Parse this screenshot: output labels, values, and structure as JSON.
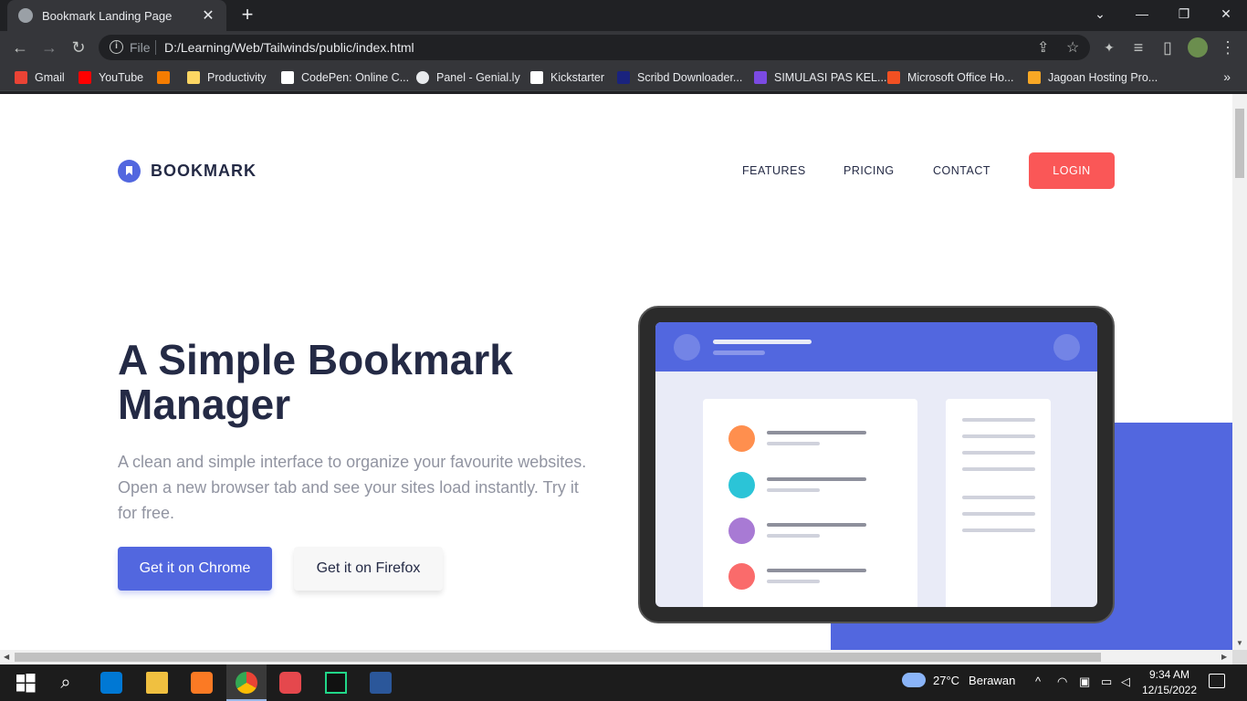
{
  "browser": {
    "tab_title": "Bookmark Landing Page",
    "tab_close": "✕",
    "new_tab": "+",
    "window_controls": {
      "chevron": "⌄",
      "minimize": "—",
      "restore": "❐",
      "close": "✕"
    },
    "nav": {
      "back": "←",
      "forward": "→",
      "reload": "↻"
    },
    "omnibox": {
      "scheme_label": "File",
      "info": "i",
      "url": "D:/Learning/Web/Tailwinds/public/index.html",
      "share": "⇪",
      "star": "☆"
    },
    "toolbar_icons": {
      "extensions": "✦",
      "media": "≡",
      "sidepanel": "▯",
      "menu": "⋮"
    },
    "bookmarks": [
      {
        "label": "Gmail",
        "color": "#ea4335"
      },
      {
        "label": "YouTube",
        "color": "#ff0000"
      },
      {
        "label": "",
        "color": "#f57c00"
      },
      {
        "label": "Productivity",
        "color": "#fdd663"
      },
      {
        "label": "CodePen: Online C...",
        "color": "#ffffff"
      },
      {
        "label": "Panel - Genial.ly",
        "color": "#e8eaed"
      },
      {
        "label": "Kickstarter",
        "color": "#ffffff"
      },
      {
        "label": "Scribd Downloader...",
        "color": "#1a237e"
      },
      {
        "label": "SIMULASI PAS KEL...",
        "color": "#7b4ae2"
      },
      {
        "label": "Microsoft Office Ho...",
        "color": "#f25022"
      },
      {
        "label": "Jagoan Hosting Pro...",
        "color": "#f9a825"
      }
    ],
    "bookmarks_more": "»"
  },
  "page": {
    "brand": "BOOKMARK",
    "nav": {
      "features": "FEATURES",
      "pricing": "PRICING",
      "contact": "CONTACT",
      "login": "LOGIN"
    },
    "hero_title": "A Simple Bookmark Manager",
    "hero_subtitle": "A clean and simple interface to organize your favourite websites. Open a new browser tab and see your sites load instantly. Try it for free.",
    "btn_chrome": "Get it on Chrome",
    "btn_firefox": "Get it on Firefox",
    "colors": {
      "primary": "#5267df",
      "accent": "#fa5757",
      "heading": "#242a45",
      "body": "#9194a1"
    },
    "illustration_dots": [
      "#ff8f4e",
      "#2bc4d7",
      "#a87ad4",
      "#fa6b6b"
    ]
  },
  "taskbar": {
    "search": "⌕",
    "weather_temp": "27°C",
    "weather_text": "Berawan",
    "tray_chevron": "^",
    "time": "9:34 AM",
    "date": "12/15/2022"
  }
}
